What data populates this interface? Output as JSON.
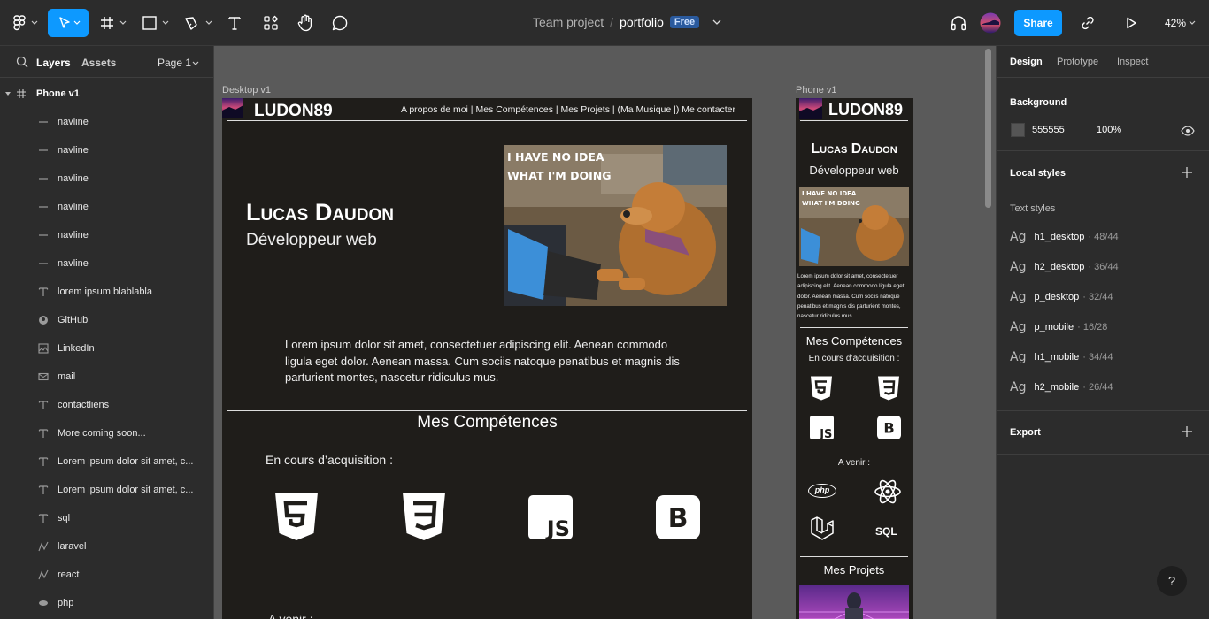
{
  "toolbar": {
    "project": "Team project",
    "separator": "/",
    "file": "portfolio",
    "plan_badge": "Free",
    "share_label": "Share",
    "zoom": "42%",
    "icons": [
      "figma-menu-icon",
      "move-tool-icon",
      "frame-tool-icon",
      "shape-tool-icon",
      "pen-tool-icon",
      "text-tool-icon",
      "components-icon",
      "hand-tool-icon",
      "comment-tool-icon",
      "headphones-icon",
      "link-icon",
      "present-play-icon"
    ]
  },
  "left_panel": {
    "tab_layers": "Layers",
    "tab_assets": "Assets",
    "page": "Page 1",
    "frame_name": "Phone v1",
    "layers": [
      {
        "icon": "line",
        "label": "navline"
      },
      {
        "icon": "line",
        "label": "navline"
      },
      {
        "icon": "line",
        "label": "navline"
      },
      {
        "icon": "line",
        "label": "navline"
      },
      {
        "icon": "line",
        "label": "navline"
      },
      {
        "icon": "line",
        "label": "navline"
      },
      {
        "icon": "text",
        "label": "lorem ipsum blablabla"
      },
      {
        "icon": "github",
        "label": "GitHub"
      },
      {
        "icon": "image",
        "label": "LinkedIn"
      },
      {
        "icon": "mail",
        "label": "mail"
      },
      {
        "icon": "text",
        "label": "contactliens"
      },
      {
        "icon": "text",
        "label": "More coming soon..."
      },
      {
        "icon": "text",
        "label": "Lorem ipsum dolor sit amet, c..."
      },
      {
        "icon": "text",
        "label": "Lorem ipsum dolor sit amet, c..."
      },
      {
        "icon": "text",
        "label": "sql"
      },
      {
        "icon": "vector",
        "label": "laravel"
      },
      {
        "icon": "vector",
        "label": "react"
      },
      {
        "icon": "php",
        "label": "php"
      }
    ]
  },
  "canvas": {
    "desktop": {
      "frame_label": "Desktop v1",
      "logo": "LUDON89",
      "nav": "A propos de moi | Mes Compétences | Mes Projets | (Ma Musique |) Me contacter",
      "name": "Lucas Daudon",
      "role": "Développeur web",
      "meme_text": [
        "I HAVE NO IDEA",
        "WHAT I'M DOING"
      ],
      "intro": "Lorem ipsum dolor sit amet, consectetuer adipiscing elit. Aenean commodo ligula eget dolor. Aenean massa. Cum sociis natoque penatibus et magnis dis parturient montes, nascetur ridiculus mus.",
      "skills_title": "Mes Compétences",
      "in_progress": "En cours d’acquisition :",
      "skills": [
        "html5-icon",
        "css3-icon",
        "js-icon",
        "bootstrap-icon"
      ],
      "coming": "A venir :"
    },
    "phone": {
      "frame_label": "Phone v1",
      "logo": "LUDON89",
      "name": "Lucas Daudon",
      "role": "Développeur web",
      "meme_text": [
        "I HAVE NO IDEA",
        "WHAT I'M DOING"
      ],
      "intro": "Lorem ipsum dolor sit amet, consectetuer adipiscing elit. Aenean commodo ligula eget dolor. Aenean massa. Cum sociis natoque penatibus et magnis dis parturient montes, nascetur ridiculus mus.",
      "skills_title": "Mes Compétences",
      "in_progress": "En cours d’acquisition :",
      "coming": "A venir :",
      "php": "php",
      "sql": "SQL",
      "projects_title": "Mes Projets"
    }
  },
  "right_panel": {
    "tabs": [
      "Design",
      "Prototype",
      "Inspect"
    ],
    "background_title": "Background",
    "bg_hex": "555555",
    "bg_opacity": "100%",
    "local_styles": "Local styles",
    "text_styles": "Text styles",
    "styles": [
      {
        "ag": "Ag",
        "name": "h1_desktop",
        "size": "· 48/44"
      },
      {
        "ag": "Ag",
        "name": "h2_desktop",
        "size": "· 36/44"
      },
      {
        "ag": "Ag",
        "name": "p_desktop",
        "size": "· 32/44"
      },
      {
        "ag": "Ag",
        "name": "p_mobile",
        "size": "· 16/28"
      },
      {
        "ag": "Ag",
        "name": "h1_mobile",
        "size": "· 34/44"
      },
      {
        "ag": "Ag",
        "name": "h2_mobile",
        "size": "· 26/44"
      }
    ],
    "export": "Export",
    "help": "?"
  },
  "colors": {
    "accent": "#0d99ff",
    "canvas": "#5a5a5a",
    "frame": "#1f1d1a",
    "panel": "#2c2c2c"
  }
}
